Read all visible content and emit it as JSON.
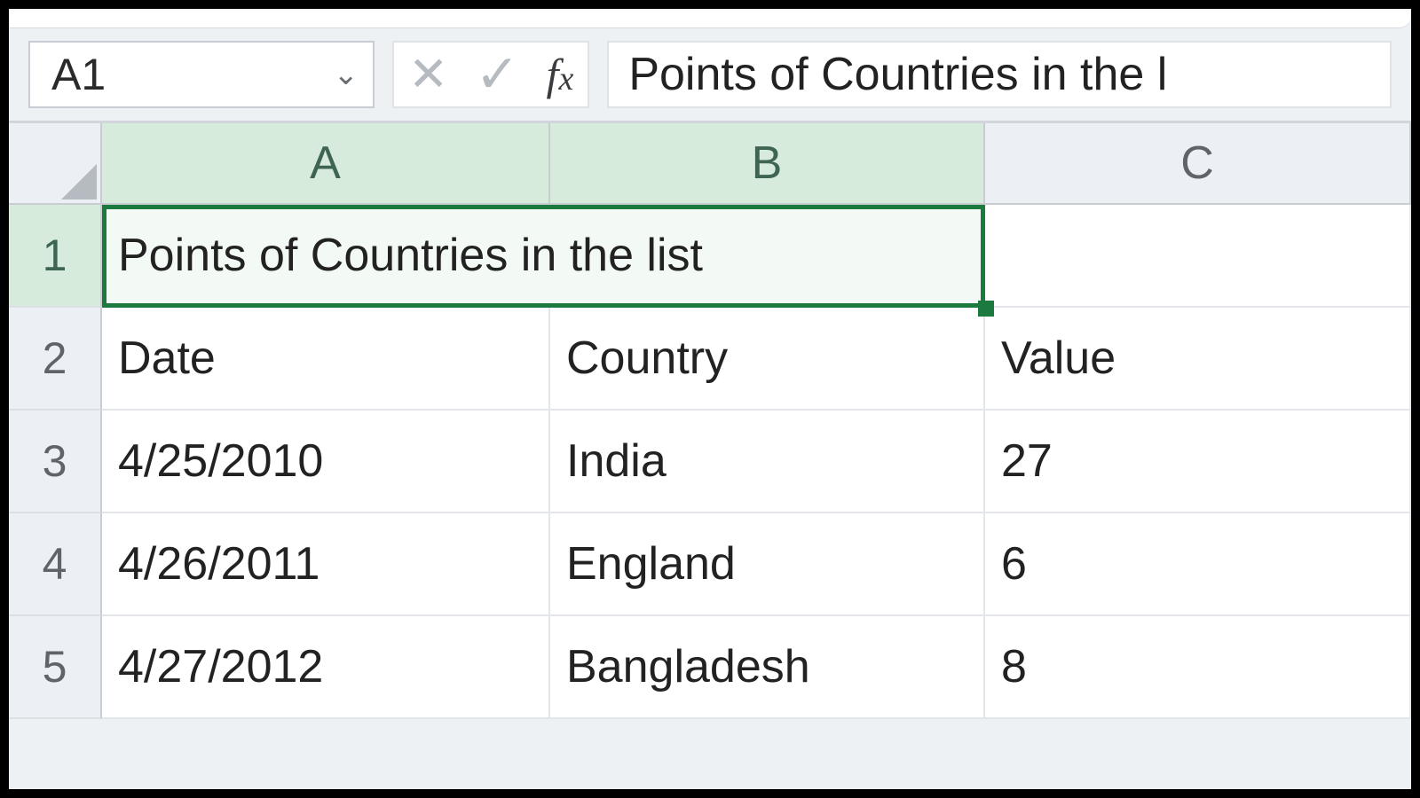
{
  "name_box": {
    "value": "A1"
  },
  "formula_bar": {
    "content": "Points of Countries in the l"
  },
  "columns": [
    "A",
    "B",
    "C"
  ],
  "selected_columns": [
    "A",
    "B"
  ],
  "rows": [
    {
      "num": "1",
      "selected": true,
      "cells": {
        "A": "Points of Countries in the list",
        "B": "",
        "C": ""
      },
      "merged_AB": true
    },
    {
      "num": "2",
      "selected": false,
      "cells": {
        "A": "Date",
        "B": "Country",
        "C": "Value"
      }
    },
    {
      "num": "3",
      "selected": false,
      "cells": {
        "A": "4/25/2010",
        "B": "India",
        "C": "27"
      }
    },
    {
      "num": "4",
      "selected": false,
      "cells": {
        "A": "4/26/2011",
        "B": "England",
        "C": "6"
      }
    },
    {
      "num": "5",
      "selected": false,
      "cells": {
        "A": "4/27/2012",
        "B": "Bangladesh",
        "C": "8"
      }
    }
  ],
  "chart_data": {
    "type": "table",
    "title": "Points of Countries in the list",
    "columns": [
      "Date",
      "Country",
      "Value"
    ],
    "rows": [
      [
        "4/25/2010",
        "India",
        27
      ],
      [
        "4/26/2011",
        "England",
        6
      ],
      [
        "4/27/2012",
        "Bangladesh",
        8
      ]
    ]
  }
}
